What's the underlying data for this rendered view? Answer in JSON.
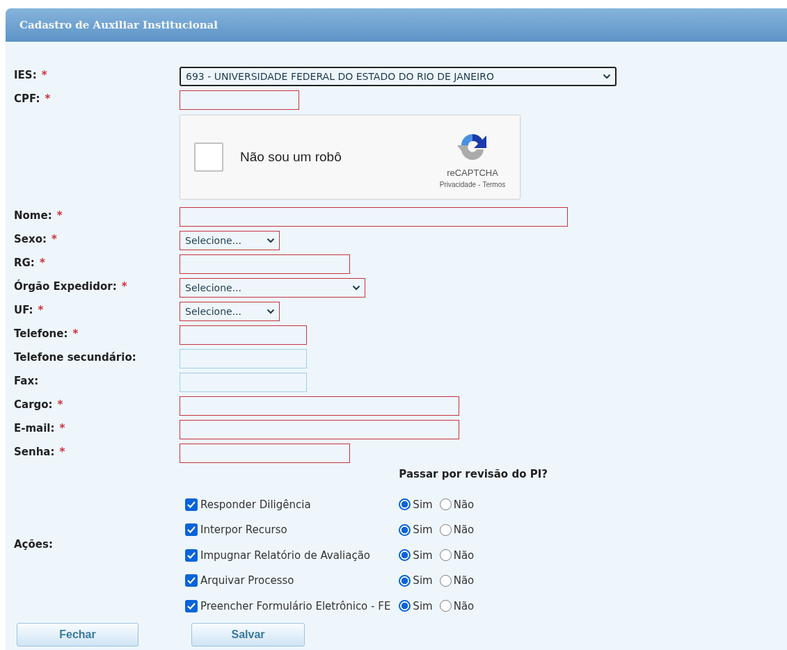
{
  "panel": {
    "title": "Cadastro de Auxiliar Institucional"
  },
  "fields": [
    {
      "label": "IES:",
      "required": true,
      "kind": "select",
      "value": "693 - UNIVERSIDADE FEDERAL DO ESTADO DO RIO DE JANEIRO",
      "focused": true
    },
    {
      "label": "CPF:",
      "required": true,
      "kind": "text",
      "focused": false
    },
    {
      "kind": "captcha",
      "checked": false,
      "text": "Não sou um robô",
      "brand": "reCAPTCHA",
      "privacy_link": "Privacidade",
      "separator": "-",
      "terms_link": "Termos"
    },
    {
      "label": "Nome:",
      "required": true,
      "kind": "text",
      "focused": false
    },
    {
      "label": "Sexo:",
      "required": true,
      "kind": "select",
      "value": "Selecione...",
      "focused": false
    },
    {
      "label": "RG:",
      "required": true,
      "kind": "text",
      "focused": false
    },
    {
      "label": "Órgão Expedidor:",
      "required": true,
      "kind": "select",
      "value": "Selecione...",
      "focused": false
    },
    {
      "label": "UF:",
      "required": true,
      "kind": "select",
      "value": "Selecione...",
      "focused": false
    },
    {
      "label": "Telefone:",
      "required": true,
      "kind": "text",
      "focused": false
    },
    {
      "label": "Telefone secundário:",
      "required": false,
      "kind": "text",
      "focused": false
    },
    {
      "label": "Fax:",
      "required": false,
      "kind": "text",
      "focused": false
    },
    {
      "label": "Cargo:",
      "required": true,
      "kind": "text",
      "focused": false
    },
    {
      "label": "E-mail:",
      "required": true,
      "kind": "text",
      "focused": false
    },
    {
      "label": "Senha:",
      "required": true,
      "kind": "text",
      "focused": false
    }
  ],
  "required_mark": "*",
  "actions": {
    "label": "Ações:",
    "review_heading": "Passar por revisão do PI?",
    "items": [
      {
        "label": "Responder Diligência",
        "checked": true,
        "options": [
          {
            "label": "Sim",
            "selected": true
          },
          {
            "label": "Não",
            "selected": false
          }
        ]
      },
      {
        "label": "Interpor Recurso",
        "checked": true,
        "options": [
          {
            "label": "Sim",
            "selected": true
          },
          {
            "label": "Não",
            "selected": false
          }
        ]
      },
      {
        "label": "Impugnar Relatório de Avaliação",
        "checked": true,
        "options": [
          {
            "label": "Sim",
            "selected": true
          },
          {
            "label": "Não",
            "selected": false
          }
        ]
      },
      {
        "label": "Arquivar Processo",
        "checked": true,
        "options": [
          {
            "label": "Sim",
            "selected": true
          },
          {
            "label": "Não",
            "selected": false
          }
        ]
      },
      {
        "label": "Preencher Formulário Eletrônico - FE",
        "checked": true,
        "options": [
          {
            "label": "Sim",
            "selected": true
          },
          {
            "label": "Não",
            "selected": false
          }
        ]
      }
    ]
  },
  "buttons": [
    "Fechar",
    "Salvar"
  ]
}
